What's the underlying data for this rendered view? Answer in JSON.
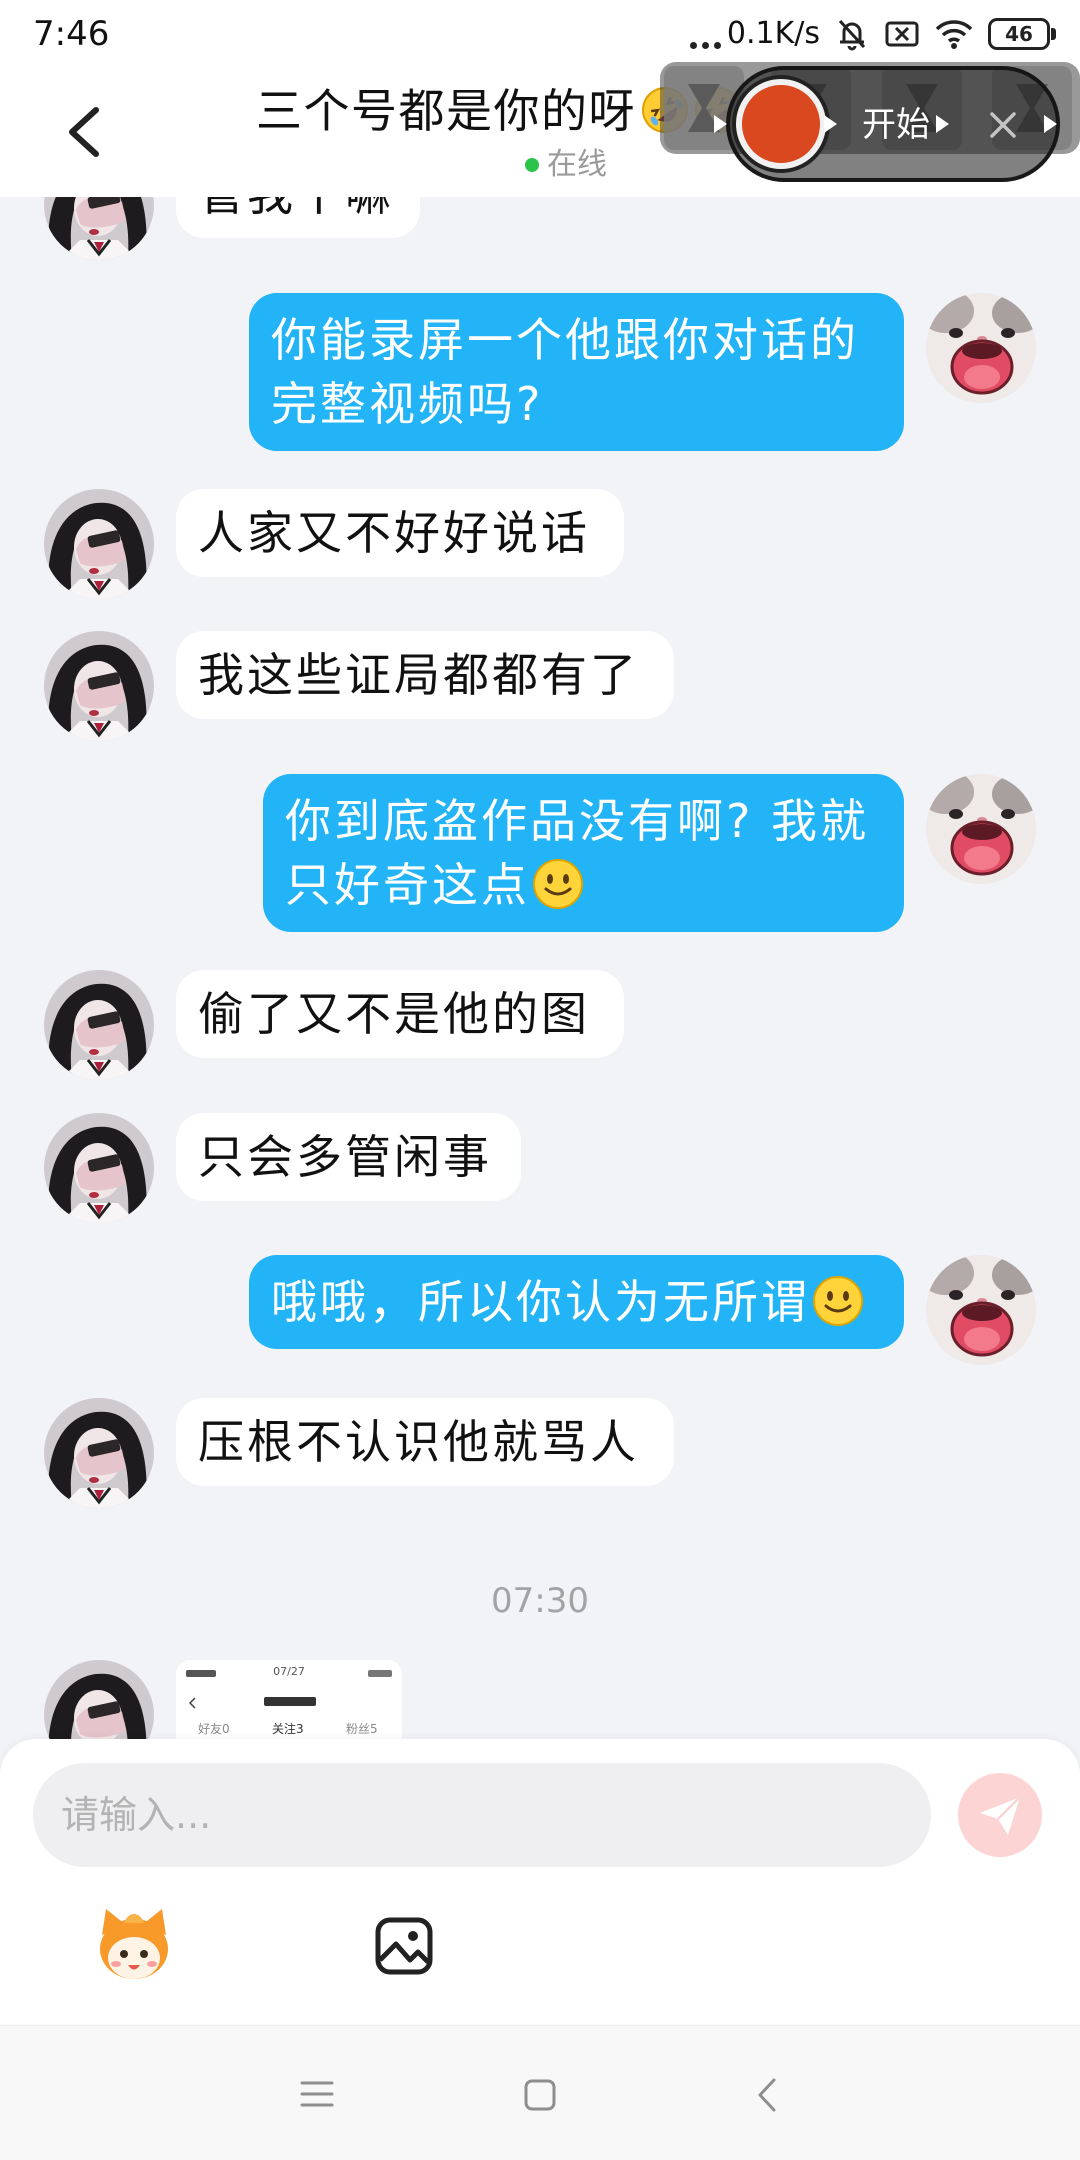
{
  "status_bar": {
    "time": "7:46",
    "network_speed": "0.1K/s",
    "battery_level": "46",
    "icons": [
      "more-dots-icon",
      "bell-off-icon",
      "no-sim-icon",
      "wifi-icon",
      "battery-icon"
    ]
  },
  "header": {
    "back_icon": "chevron-left-icon",
    "title": "三个号都是你的呀",
    "title_emojis": [
      "rolling-on-the-floor-laughing",
      "rolling-on-the-floor-laughing"
    ],
    "presence": "在线"
  },
  "screen_recorder": {
    "start_label": "开始",
    "icons": [
      "record-button-icon",
      "play-icon",
      "close-icon"
    ]
  },
  "messages": [
    {
      "side": "left",
      "text": "管我干嘛"
    },
    {
      "side": "right",
      "text": "你能录屏一个他跟你对话的完整视频吗?"
    },
    {
      "side": "left",
      "text": "人家又不好好说话"
    },
    {
      "side": "left",
      "text": "我这些证局都都有了"
    },
    {
      "side": "right",
      "text": "你到底盗作品没有啊? 我就只好奇这点",
      "trailing_emoji": "slightly-smiling-face"
    },
    {
      "side": "left",
      "text": "偷了又不是他的图"
    },
    {
      "side": "left",
      "text": "只会多管闲事"
    },
    {
      "side": "right",
      "text": "哦哦，所以你认为无所谓",
      "trailing_emoji": "slightly-smiling-face"
    },
    {
      "side": "left",
      "text": "压根不认识他就骂人"
    }
  ],
  "time_divider": "07:30",
  "image_message": {
    "side": "left",
    "thumbnail": {
      "date": "07/27",
      "tabs": [
        "好友0",
        "关注3",
        "粉丝5"
      ]
    }
  },
  "composer": {
    "placeholder": "请输入...",
    "send_icon": "paper-plane-send-icon",
    "tools": [
      "mascot-sticker-icon",
      "image-picker-icon"
    ]
  },
  "nav_bar": {
    "icons": [
      "menu-icon",
      "home-square-icon",
      "back-chevron-icon"
    ]
  },
  "colors": {
    "outgoing_bubble": "#22b4f6",
    "incoming_bubble": "#ffffff",
    "chat_background": "#f2f3f7",
    "online_dot": "#2bc44a",
    "send_button": "#fcd4d4",
    "record_button": "#d9481e"
  }
}
